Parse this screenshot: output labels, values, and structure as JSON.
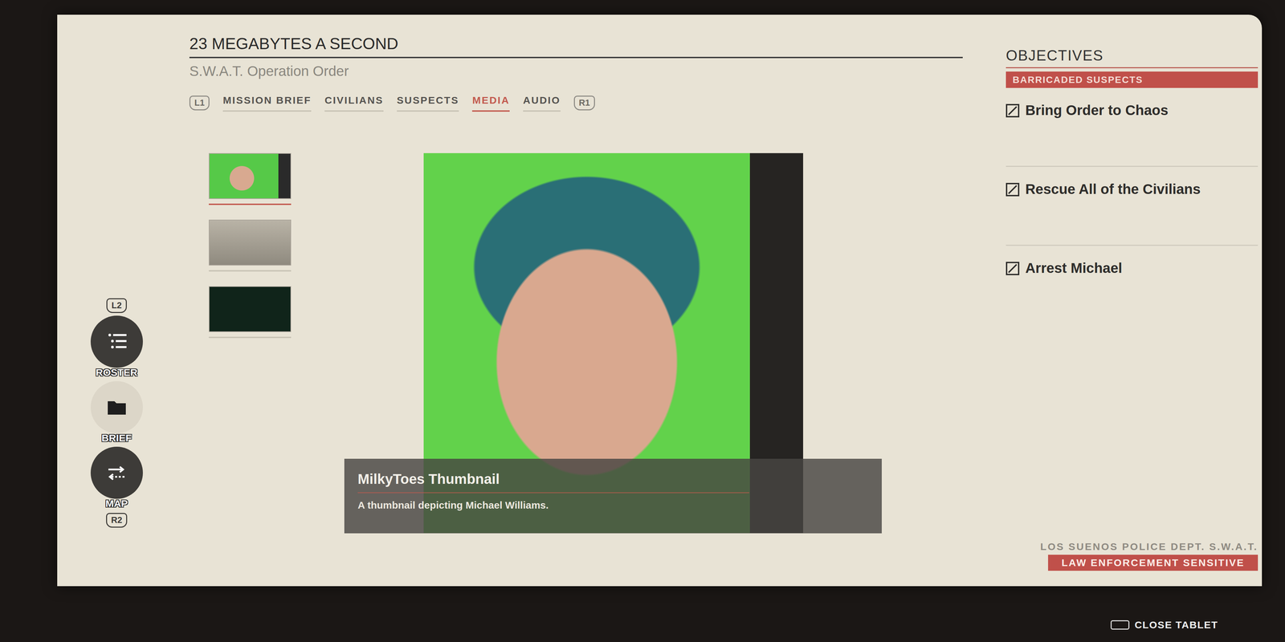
{
  "mission": {
    "title": "23 MEGABYTES A SECOND",
    "subtitle": "S.W.A.T. Operation Order"
  },
  "tab_keys": {
    "prev": "L1",
    "next": "R1"
  },
  "tabs": [
    {
      "label": "MISSION BRIEF",
      "selected": false
    },
    {
      "label": "CIVILIANS",
      "selected": false
    },
    {
      "label": "SUSPECTS",
      "selected": false
    },
    {
      "label": "MEDIA",
      "selected": true
    },
    {
      "label": "AUDIO",
      "selected": false
    }
  ],
  "media": {
    "thumbnails": [
      {
        "selected": true
      },
      {
        "selected": false
      },
      {
        "selected": false
      }
    ],
    "caption": {
      "title": "MilkyToes Thumbnail",
      "description": "A thumbnail depicting Michael Williams."
    }
  },
  "side_menu": {
    "top_key": "L2",
    "bottom_key": "R2",
    "items": [
      {
        "label": "ROSTER",
        "selected": false
      },
      {
        "label": "BRIEF",
        "selected": true
      },
      {
        "label": "MAP",
        "selected": false
      }
    ]
  },
  "objectives": {
    "heading": "OBJECTIVES",
    "category": "BARRICADED SUSPECTS",
    "items": [
      {
        "label": "Bring Order to Chaos"
      },
      {
        "label": "Rescue All of the Civilians"
      },
      {
        "label": "Arrest Michael"
      }
    ]
  },
  "footer": {
    "department": "LOS SUENOS POLICE DEPT. S.W.A.T.",
    "classification": "LAW ENFORCEMENT SENSITIVE"
  },
  "close_button": {
    "label": "CLOSE TABLET"
  }
}
